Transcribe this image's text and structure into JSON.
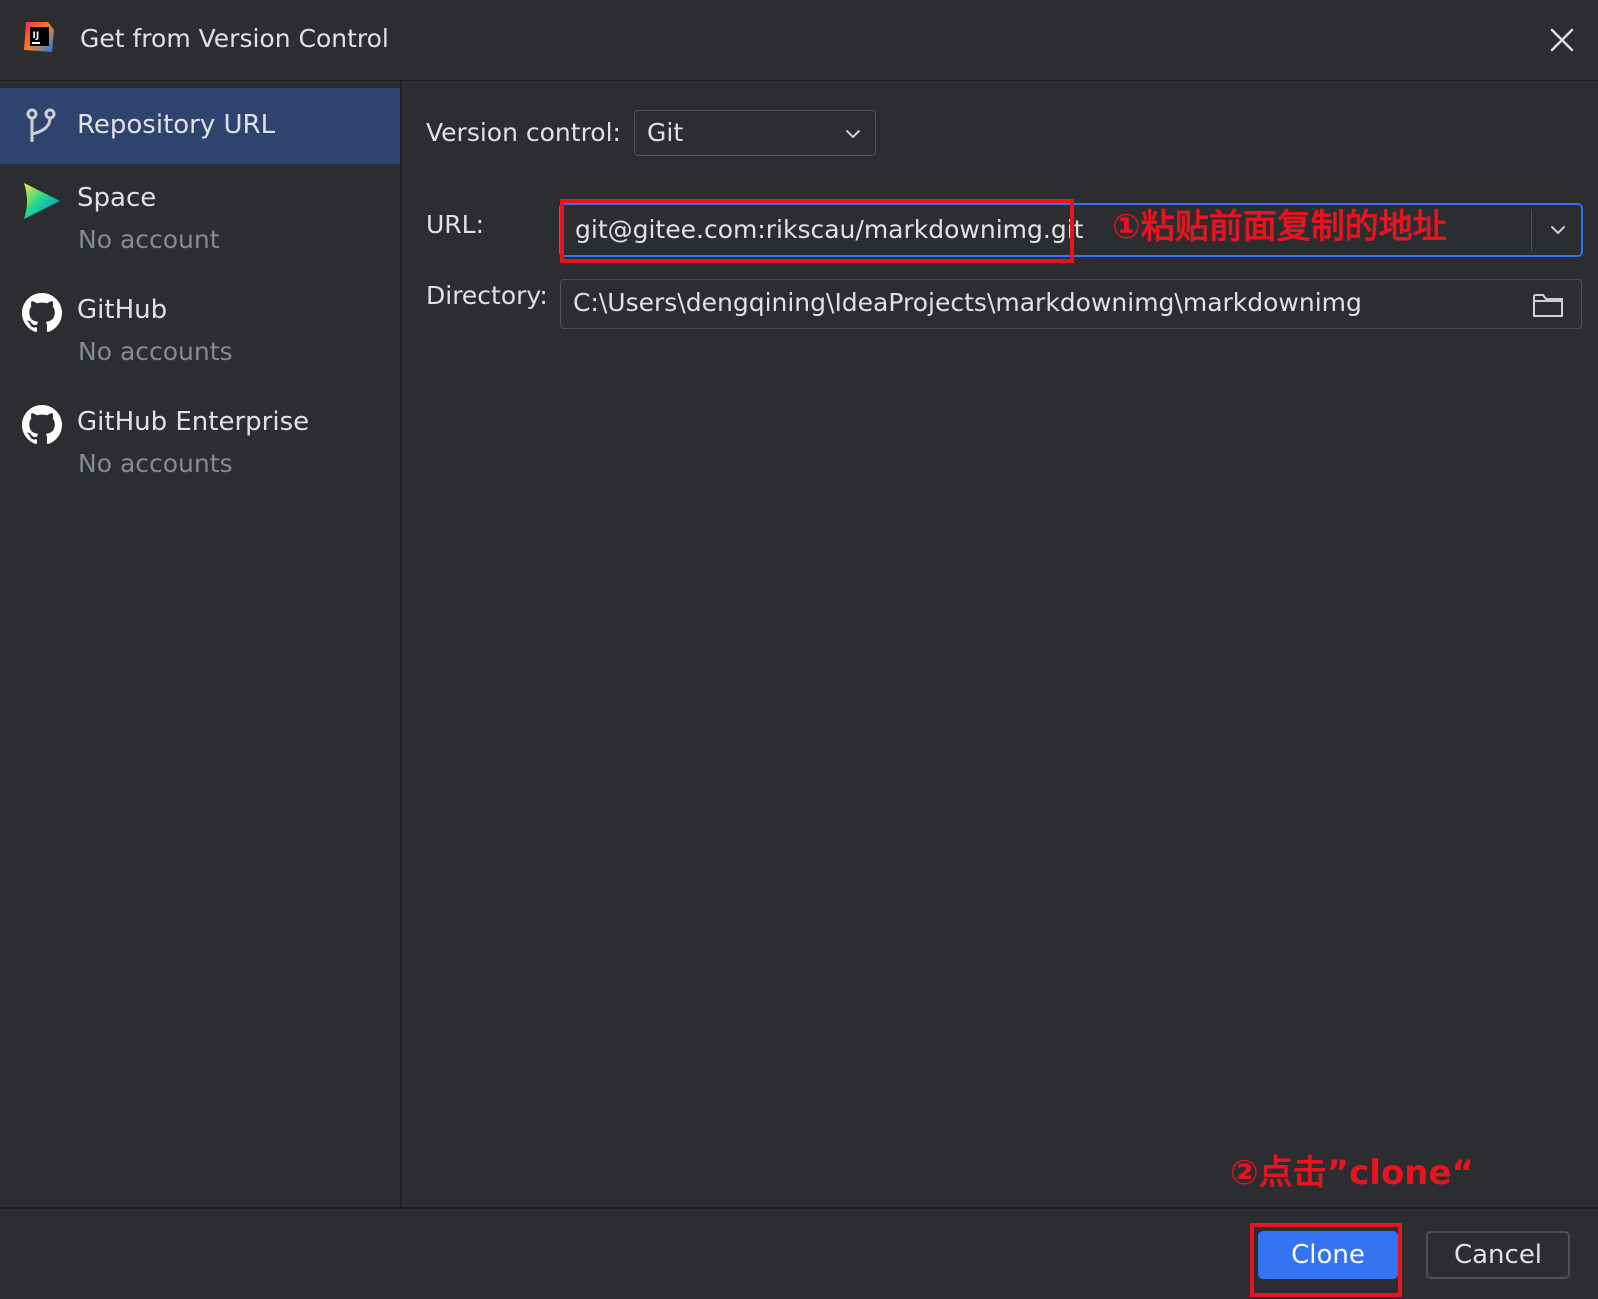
{
  "window": {
    "title": "Get from Version Control",
    "app_icon": "intellij-idea-icon",
    "close_icon": "close-icon"
  },
  "sidebar": {
    "items": [
      {
        "title": "Repository URL",
        "subtitle": "",
        "icon": "git-branch-icon",
        "selected": true
      },
      {
        "title": "Space",
        "subtitle": "No account",
        "icon": "space-icon",
        "selected": false
      },
      {
        "title": "GitHub",
        "subtitle": "No accounts",
        "icon": "github-icon",
        "selected": false
      },
      {
        "title": "GitHub Enterprise",
        "subtitle": "No accounts",
        "icon": "github-icon",
        "selected": false
      }
    ]
  },
  "form": {
    "version_control_label": "Version control:",
    "version_control_value": "Git",
    "url_label": "URL:",
    "url_value": "git@gitee.com:rikscau/markdownimg.git",
    "directory_label": "Directory:",
    "directory_value": "C:\\Users\\dengqining\\IdeaProjects\\markdownimg\\markdownimg"
  },
  "annotations": {
    "step1": "①粘贴前面复制的地址",
    "step2": "②点击”clone“"
  },
  "footer": {
    "clone_label": "Clone",
    "cancel_label": "Cancel"
  },
  "colors": {
    "background": "#2b2d30",
    "selected": "#2e436e",
    "accent": "#3574f0",
    "annotation_red": "#e6141e",
    "text": "#dfe1e5",
    "muted_text": "#868a91"
  }
}
